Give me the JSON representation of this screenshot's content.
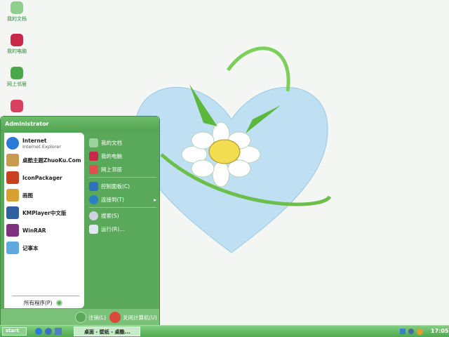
{
  "desktop": {
    "icons": [
      {
        "label": "我的文档",
        "color": "#8fd08f"
      },
      {
        "label": "我的电脑",
        "color": "#c8284a"
      },
      {
        "label": "网上邻居",
        "color": "#4aa84a"
      },
      {
        "label": "",
        "color": "#d84060"
      }
    ]
  },
  "start_menu": {
    "user": "Administrator",
    "pinned": [
      {
        "title": "Internet",
        "subtitle": "Internet Explorer",
        "icon": "ie-icon",
        "color": "#2a7ad8"
      },
      {
        "title": "桌酷主题ZhuoKu.Com",
        "icon": "zhuoku-icon",
        "color": "#c89a50"
      },
      {
        "title": "IconPackager",
        "icon": "iconpackager-icon",
        "color": "#c84020"
      },
      {
        "title": "画图",
        "icon": "paint-icon",
        "color": "#d8a030"
      },
      {
        "title": "KMPlayer中文版",
        "icon": "kmplayer-icon",
        "color": "#3060a0"
      },
      {
        "title": "WinRAR",
        "icon": "winrar-icon",
        "color": "#803080"
      },
      {
        "title": "记事本",
        "icon": "notepad-icon",
        "color": "#60a8e0"
      }
    ],
    "all_programs": "所有程序(P)",
    "places": [
      {
        "label": "我的文档",
        "icon": "my-documents-icon",
        "color": "#9ad49a"
      },
      {
        "label": "我的电脑",
        "icon": "my-computer-icon",
        "color": "#c8284a"
      },
      {
        "label": "网上邻居",
        "icon": "network-icon",
        "color": "#e05050"
      },
      {
        "label": "控制面板(C)",
        "icon": "control-panel-icon",
        "color": "#3070c0"
      },
      {
        "label": "连接到(T)",
        "icon": "connect-icon",
        "color": "#2a80c8"
      },
      {
        "label": "搜索(S)",
        "icon": "search-icon",
        "color": "#d0d0e0"
      },
      {
        "label": "运行(R)...",
        "icon": "run-icon",
        "color": "#e0e8f0"
      }
    ],
    "logoff": "注销(L)",
    "shutdown": "关闭计算机(U)"
  },
  "taskbar": {
    "start": "start",
    "task": "桌面 - 壁纸 - 桌酷...",
    "clock": "17:05"
  }
}
